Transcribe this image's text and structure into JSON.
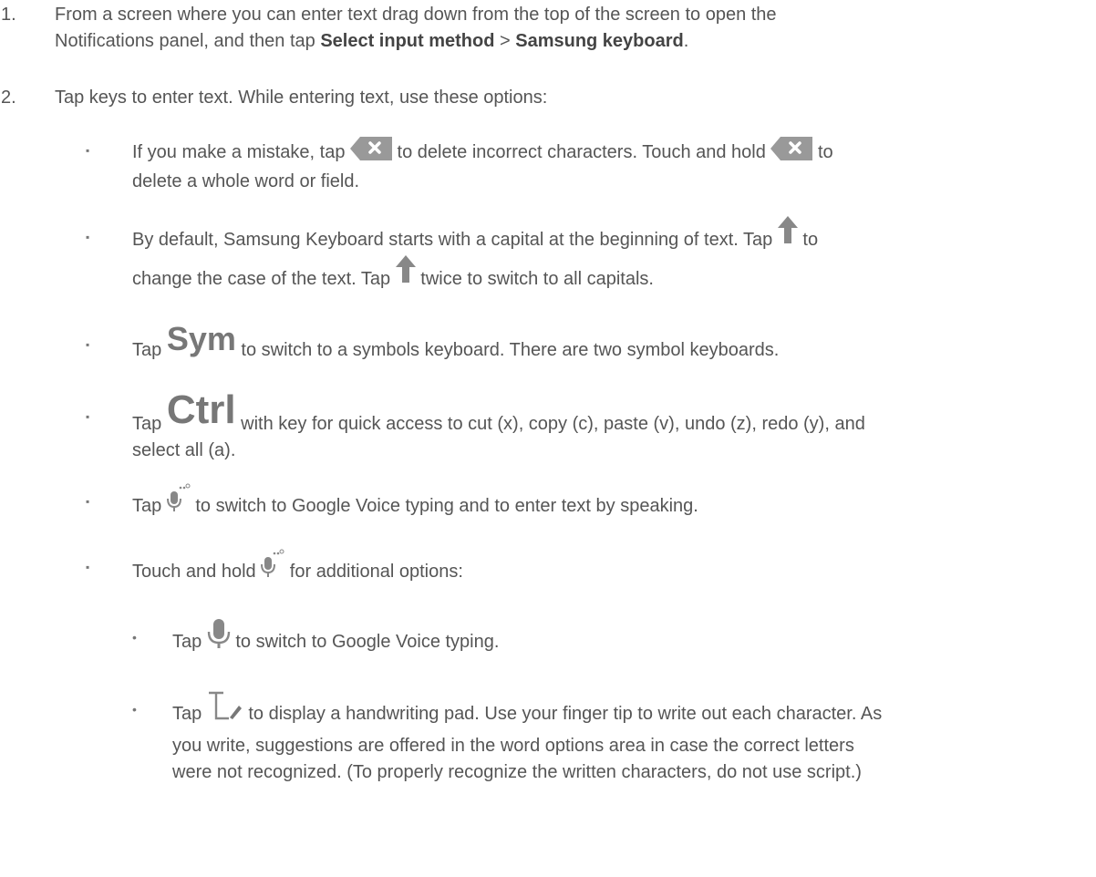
{
  "steps": [
    {
      "num": "1.",
      "line1": "From a screen where you can enter text drag down from the top of the screen to open the",
      "line2_pre": "Notifications panel, and then tap ",
      "b1": "Select input method",
      "sep": " > ",
      "b2": "Samsung keyboard",
      "end": "."
    },
    {
      "num": "2.",
      "text": "Tap keys to enter text. While entering text, use these options:"
    }
  ],
  "options": {
    "delete": {
      "p1": "If you make a mistake, tap ",
      "p2": " to delete incorrect characters. Touch and hold ",
      "p3": " to",
      "p4": "delete a whole word or field.",
      "icon": "backspace-key-icon"
    },
    "shift": {
      "p1": "By default, Samsung Keyboard starts with a capital at the beginning of text. Tap ",
      "p2": " to",
      "p3": "change the case of the text. Tap ",
      "p4": " twice to switch to all capitals.",
      "icon": "shift-arrow-icon"
    },
    "sym": {
      "p1": "Tap ",
      "key": "Sym",
      "p2": " to switch to a symbols keyboard. There are two symbol keyboards."
    },
    "ctrl": {
      "p1": "Tap ",
      "key": "Ctrl",
      "p2": " with key for quick access to cut (x), copy (c), paste (v), undo (z), redo (y), and",
      "p3": "select all (a)."
    },
    "voice": {
      "p1": "Tap ",
      "p2": "  to switch to Google Voice typing and to enter text by speaking.",
      "icon": "microphone-dots-icon"
    },
    "hold": {
      "p1": "Touch and hold ",
      "p2": "  for additional options:"
    }
  },
  "sub_options": {
    "mic": {
      "p1": "Tap ",
      "p2": " to switch to Google Voice typing.",
      "icon": "microphone-icon"
    },
    "hand": {
      "p1": "Tap ",
      "p2": " to display a handwriting pad. Use your finger tip to write out each character. As",
      "p3": "you write, suggestions are offered in the word options area in case the correct letters",
      "p4": "were not recognized. (To properly recognize the written characters, do not use script.)",
      "icon": "handwriting-icon"
    }
  },
  "glyphs": {
    "bullet": "▪",
    "dot": "•"
  },
  "colors": {
    "text": "#555555",
    "icon": "#888888",
    "key_bg": "#999999"
  }
}
